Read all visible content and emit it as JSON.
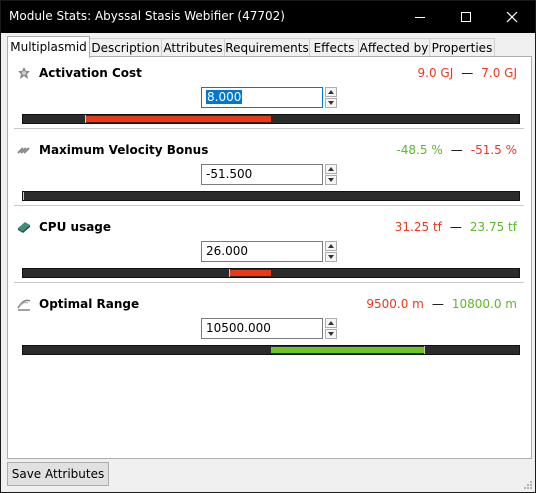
{
  "window": {
    "title": "Module Stats: Abyssal Stasis Webifier (47702)",
    "controls": [
      "minimize-icon",
      "maximize-icon",
      "close-icon"
    ]
  },
  "tabs": [
    {
      "label": "Multiplasmid",
      "active": true
    },
    {
      "label": "Description",
      "active": false
    },
    {
      "label": "Attributes",
      "active": false
    },
    {
      "label": "Requirements",
      "active": false
    },
    {
      "label": "Effects",
      "active": false
    },
    {
      "label": "Affected by",
      "active": false
    },
    {
      "label": "Properties",
      "active": false
    }
  ],
  "stats": [
    {
      "name": "Activation Cost",
      "icon": "capacitor-icon",
      "range_low": "9.0 GJ",
      "range_low_color": "#e8391d",
      "range_sep": "—",
      "range_high": "7.0 GJ",
      "range_high_color": "#e8391d",
      "value": "8.000",
      "bar": {
        "fill_from": 0.5,
        "fill_to": 0.125,
        "color": "#e8391d"
      }
    },
    {
      "name": "Maximum Velocity Bonus",
      "icon": "velocity-icon",
      "range_low": "-48.5 %",
      "range_low_color": "#5cb82a",
      "range_sep": "—",
      "range_high": "-51.5 %",
      "range_high_color": "#e8391d",
      "value": "-51.500",
      "bar": {
        "fill_from": 0.0,
        "fill_to": 0.0,
        "color": "#e8391d"
      }
    },
    {
      "name": "CPU usage",
      "icon": "cpu-icon",
      "range_low": "31.25 tf",
      "range_low_color": "#e8391d",
      "range_sep": "—",
      "range_high": "23.75 tf",
      "range_high_color": "#5cb82a",
      "value": "26.000",
      "bar": {
        "fill_from": 0.5,
        "fill_to": 0.415,
        "color": "#e8391d"
      }
    },
    {
      "name": "Optimal Range",
      "icon": "range-icon",
      "range_low": "9500.0 m",
      "range_low_color": "#e8391d",
      "range_sep": "—",
      "range_high": "10800.0 m",
      "range_high_color": "#5cb82a",
      "value": "10500.000",
      "bar": {
        "fill_from": 0.5,
        "fill_to": 0.808,
        "color": "#6cc520"
      }
    }
  ],
  "footer": {
    "save_label": "Save Attributes"
  }
}
